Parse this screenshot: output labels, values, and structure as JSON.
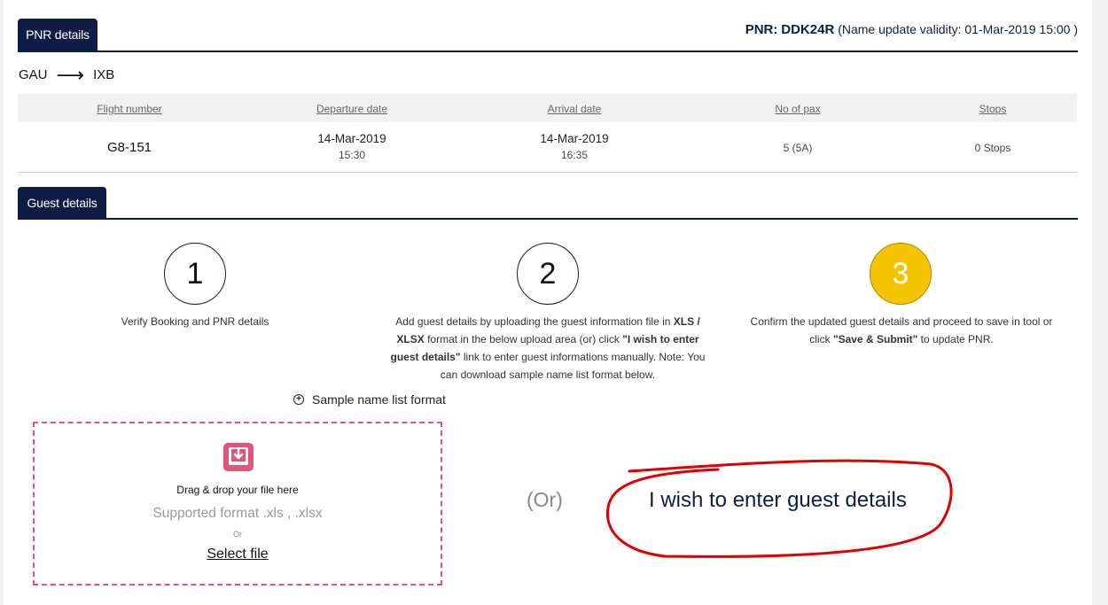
{
  "pnr_section": {
    "tab_label": "PNR details",
    "pnr_label": "PNR:",
    "pnr_code": "DDK24R",
    "validity": "(Name update validity: 01-Mar-2019 15:00 )"
  },
  "route": {
    "origin": "GAU",
    "arrow_icon": "long-right-arrow",
    "destination": "IXB"
  },
  "flight_table": {
    "headers": [
      "Flight number",
      "Departure date",
      "Arrival date",
      "No of pax",
      "Stops"
    ],
    "row": {
      "flight_number": "G8-151",
      "departure_date": "14-Mar-2019",
      "departure_time": "15:30",
      "arrival_date": "14-Mar-2019",
      "arrival_time": "16:35",
      "pax": "5 (5A)",
      "stops": "0 Stops"
    }
  },
  "guest_section": {
    "tab_label": "Guest details",
    "steps": [
      {
        "number": "1",
        "text": "Verify Booking and PNR details",
        "active": false
      },
      {
        "number": "2",
        "active": false,
        "t1": "Add guest details by uploading the guest information file in ",
        "b1": "XLS / XLSX",
        "t2": " format in the below upload area (or) click ",
        "b2": "\"I wish to enter guest details\"",
        "t3": " link to enter guest informations manually. Note: You can download sample name list format below."
      },
      {
        "number": "3",
        "active": true,
        "t1": "Confirm the updated guest details and proceed to save in tool or click ",
        "b1": "\"Save & Submit\"",
        "t2": " to update PNR."
      }
    ],
    "sample_link": "Sample name list format",
    "sample_icon": "plus-circle-icon"
  },
  "upload": {
    "icon": "upload-tray-icon",
    "title": "Drag & drop your file here",
    "formats": "Supported format .xls , .xlsx",
    "or": "Or",
    "select_label": "Select file"
  },
  "alt": {
    "or_label": "(Or)",
    "manual_link": "I wish to enter guest details"
  },
  "colors": {
    "navy": "#0f1d44",
    "active_step": "#f5c400",
    "dropzone": "#e0557a",
    "annotation": "#e00000"
  }
}
